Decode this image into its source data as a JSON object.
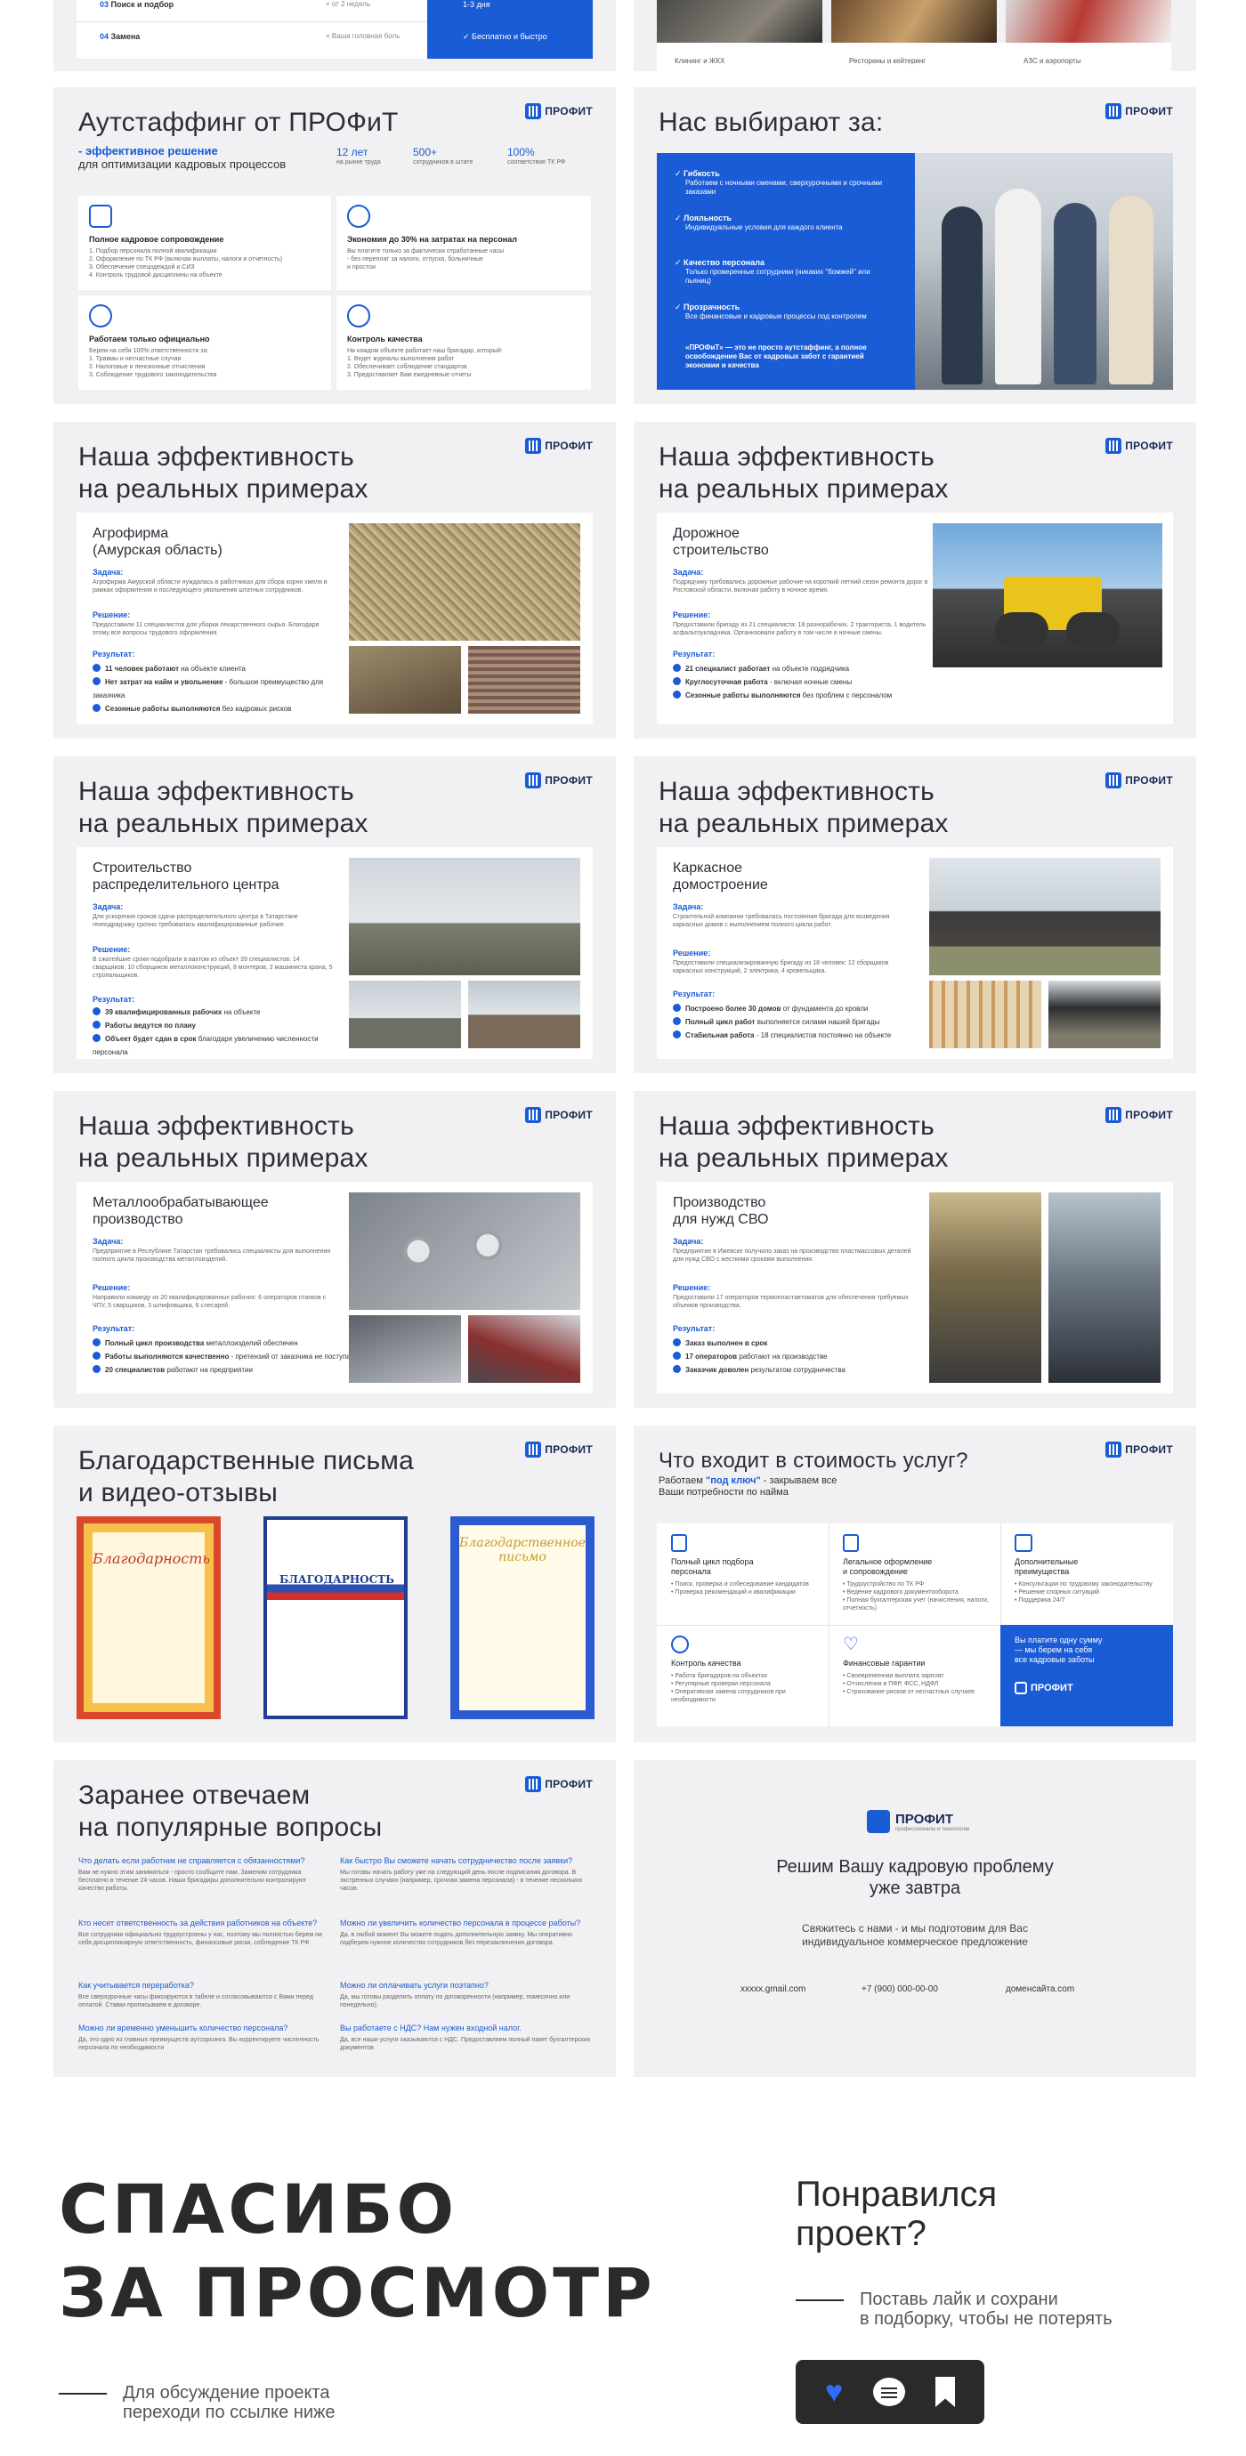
{
  "colors": {
    "accent": "#1a5bd6",
    "bg": "#f1f1f3",
    "dark": "#2a2a2a"
  },
  "logo": {
    "text": "ПРОФИТ"
  },
  "top_left": {
    "rows": [
      {
        "num": "03",
        "label": "Поиск и подбор",
        "mid": "от 2 недель"
      },
      {
        "num": "04",
        "label": "Замена",
        "mid": "Ваша головная боль"
      }
    ],
    "blue": {
      "top": "1-3 дня",
      "bottom": "Бесплатно и быстро"
    }
  },
  "top_right": {
    "captions": [
      "Клининг и ЖКХ",
      "Рестораны и кейтеринг",
      "АЗС и аэропорты"
    ]
  },
  "outstaff": {
    "title": "Аутстаффинг от ПРОФиТ",
    "lead_blue": "- эффективное решение",
    "lead": "для оптимизации кадровых процессов",
    "stats": [
      {
        "value": "12 лет",
        "label": "на рынке труда"
      },
      {
        "value": "500+",
        "label": "сотрудников в штате"
      },
      {
        "value": "100%",
        "label": "соответствие ТК РФ"
      }
    ],
    "cards": [
      {
        "title": "Полное кадровое сопровождение",
        "items": [
          "1. Подбор персонала полной квалификации",
          "2. Оформление по ТК РФ (включая выплаты, налоги и отчетность)",
          "3. Обеспечение спецодеждой и СИЗ",
          "4. Контроль трудовой дисциплины на объекте"
        ]
      },
      {
        "title": "Экономия до 30% на затратах на персонал",
        "items": [
          "Вы платите только за фактически отработанные часы",
          "- без переплат за налоги, отпуска, больничные",
          "и простои"
        ]
      },
      {
        "title": "Работаем только официально",
        "items": [
          "Берем на себя 100% ответственности за:",
          "1. Травмы и несчастные случаи",
          "2. Налоговые и пенсионные отчисления",
          "3. Соблюдение трудового законодательства"
        ]
      },
      {
        "title": "Контроль качества",
        "items": [
          "На каждом объекте работает наш бригадир, который:",
          "1. Ведет журналы выполнения работ",
          "2. Обеспечивает соблюдение стандартов",
          "3. Предоставляет Вам ежедневные отчеты"
        ]
      }
    ]
  },
  "why": {
    "title": "Нас выбирают за:",
    "items": [
      {
        "title": "Гибкость",
        "text": "Работаем с ночными сменами, сверхурочными и срочными заказами"
      },
      {
        "title": "Лояльность",
        "text": "Индивидуальные условия для каждого клиента"
      },
      {
        "title": "Качество персонала",
        "text": "Только проверенные сотрудники (никаких \"бомжей\" или пьяниц)"
      },
      {
        "title": "Прозрачность",
        "text": "Все финансовые и кадровые процессы под контролем"
      }
    ],
    "footer": "«ПРОФиТ» — это не просто аутстаффинг, а полное освобождение Вас от кадровых забот с гарантией экономии и качества"
  },
  "cases": [
    {
      "title": "Наша эффективность\nна реальных примерах",
      "name": "Агрофирма\n(Амурская область)",
      "task": "Агрофирма Амурской области нуждалась в работниках для сбора корня хмеля в рамках оформления и последующего увольнения штатных сотрудников.",
      "decision": "Предоставили 11 специалистов для уборки лекарственного сырья. Благодаря этому все вопросы трудового оформления.",
      "results": [
        [
          "11 человек работают",
          "на объекте клиента"
        ],
        [
          "Нет затрат на найм и увольнение",
          "- большое преимущество для заказчика"
        ],
        [
          "Сезонные работы выполняются",
          "без кадровых рисков"
        ]
      ]
    },
    {
      "title": "Наша эффективность\nна реальных примерах",
      "name": "Дорожное\nстроительство",
      "task": "Подрядчику требовались дорожные рабочие на короткий летний сезон ремонта дорог в Ростовской области, включая работу в ночное время.",
      "decision": "Предоставили бригаду из 21 специалиста: 18 разнорабочих, 2 тракториста, 1 водитель асфальтоукладчика. Организовали работу в том числе в ночные смены.",
      "results": [
        [
          "21 специалист работает",
          "на объекте подрядчика"
        ],
        [
          "Круглосуточная работа",
          "- включая ночные смены"
        ],
        [
          "Сезонные работы выполняются",
          "без проблем с персоналом"
        ]
      ]
    },
    {
      "title": "Наша эффективность\nна реальных примерах",
      "name": "Строительство\nраспределительного центра",
      "task": "Для ускорения сроков сдачи распределительного центра в Татарстане генподрядчику срочно требовались квалифицированные рабочие.",
      "decision": "В сжатейшие сроки подобрали в вахтом из объект 39 специалистов: 14 сварщиков, 10 сборщиков металлоконструкций, 8 монтеров, 2 машиниста крана, 5 стропальщиков.",
      "results": [
        [
          "39 квалифицированных рабочих",
          "на объекте"
        ],
        [
          "Работы ведутся по плану",
          ""
        ],
        [
          "Объект будет сдан в срок",
          "благодаря увеличению численности персонала"
        ]
      ]
    },
    {
      "title": "Наша эффективность\nна реальных примерах",
      "name": "Каркасное\nдомостроение",
      "task": "Строительной компании требовалась постоянная бригада для возведения каркасных домов с выполнением полного цикла работ.",
      "decision": "Предоставили специализированную бригаду из 18 человек: 12 сборщиков каркасных конструкций, 2 электрика, 4 кровельщика.",
      "results": [
        [
          "Построено более 30 домов",
          "от фундамента до кровли"
        ],
        [
          "Полный цикл работ",
          "выполняется силами нашей бригады"
        ],
        [
          "Стабильная работа",
          "- 18 специалистов постоянно на объекте"
        ]
      ]
    },
    {
      "title": "Наша эффективность\nна реальных примерах",
      "name": "Металлообрабатывающее\nпроизводство",
      "task": "Предприятие в Республике Татарстан требовались специалисты для выполнения полного цикла производства металлоизделий.",
      "decision": "Направили команду из 20 квалифицированных рабочих: 6 операторов станков с ЧПУ, 5 сварщиков, 3 шлифовщика, 6 слесарей.",
      "results": [
        [
          "Полный цикл производства",
          "металлоизделий обеспечен"
        ],
        [
          "Работы выполняются качественно",
          "- претензий от заказчика не поступало"
        ],
        [
          "20 специалистов",
          "работают на предприятии"
        ]
      ]
    },
    {
      "title": "Наша эффективность\nна реальных примерах",
      "name": "Производство\nдля нужд СВО",
      "task": "Предприятие в Ижевске получило заказ на производство пластмассовых деталей для нужд СВО с жесткими сроками выполнения.",
      "decision": "Предоставили 17 операторов термопластавтоматов для обеспечения требуемых объемов производства.",
      "results": [
        [
          "Заказ выполнен в срок",
          ""
        ],
        [
          "17 операторов",
          "работают на производстве"
        ],
        [
          "Заказчик доволен",
          "результатом сотрудничества"
        ]
      ]
    }
  ],
  "thanks": {
    "title": "Благодарственные письма\nи видео-отзывы",
    "letters": [
      "Благодарность",
      "БЛАГОДАРНОСТЬ",
      "Благодарственное письмо"
    ]
  },
  "cost": {
    "title": "Что входит в стоимость услуг?",
    "sub_pre": "Работаем ",
    "sub_blue": "\"под ключ\"",
    "sub_post": " - закрываем все\nВаши потребности по найма",
    "cells": [
      {
        "title": "Полный цикл подбора\nперсонала",
        "items": [
          "Поиск, проверка и собеседование кандидатов",
          "Проверка рекомендаций и квалификации"
        ]
      },
      {
        "title": "Легальное оформление\nи сопровождение",
        "items": [
          "Трудоустройство по ТК РФ",
          "Ведение кадрового документооборота",
          "Полная бухгалтерская учет (начисления, налоги, отчетность)"
        ]
      },
      {
        "title": "Дополнительные\nпреимущества",
        "items": [
          "Консультации по трудовому законодательству",
          "Решение спорных ситуаций",
          "Поддержка 24/7"
        ]
      },
      {
        "title": "Контроль качества",
        "items": [
          "Работа бригадиров на объектах",
          "Регулярные проверки персонала",
          "Оперативная замена сотрудников при необходимости"
        ]
      },
      {
        "title": "Финансовые гарантии",
        "items": [
          "Своевременная выплата зарплат",
          "Отчисления в ПФР, ФСС, НДФЛ",
          "Страхование рисков от несчастных случаев"
        ]
      }
    ],
    "blue": "Вы платите одну сумму\n— мы берем на себя\nвсе кадровые заботы"
  },
  "faq": {
    "title": "Заранее отвечаем\nна популярные вопросы",
    "items": [
      {
        "q": "Что делать если работник не справляется с обязанностями?",
        "a": "Вам не нужно этим заниматься - просто сообщите нам. Заменим сотрудника бесплатно в течение 24 часов. Наши бригадиры дополнительно контролируют качество работы."
      },
      {
        "q": "Как быстро Вы сможете начать сотрудничество после заявки?",
        "a": "Мы готовы начать работу уже на следующий день после подписания договора. В экстренных случаях (например, срочная замена персонала) - в течение нескольких часов."
      },
      {
        "q": "Кто несет ответственность за действия работников на объекте?",
        "a": "Все сотрудники официально трудоустроены у нас, поэтому мы полностью берем на себя дисциплинарную ответственность, финансовые риски, соблюдение ТК РФ."
      },
      {
        "q": "Можно ли увеличить количество персонала в процессе работы?",
        "a": "Да, в любой момент Вы можете подать дополнительную заявку. Мы оперативно подберем нужное количество сотрудников без перезаключения договора."
      },
      {
        "q": "Как учитывается переработка?",
        "a": "Все сверхурочные часы фиксируются в табеле и согласовываются с Вами перед оплатой. Ставки прописываем в договоре."
      },
      {
        "q": "Можно ли оплачивать услуги поэтапно?",
        "a": "Да, мы готовы разделить оплату по договоренности (например, помесячно или понедельно)."
      },
      {
        "q": "Можно ли временно уменьшить количество персонала?",
        "a": "Да, это одно из главных преимуществ аутсорсинга. Вы корректируете численность персонала по необходимости"
      },
      {
        "q": "Вы работаете с НДС? Нам нужен входной налог.",
        "a": "Да, все наши услуги оказываются с НДС. Предоставляем полный пакет бухгалтерских документов"
      }
    ]
  },
  "contact": {
    "logo_sub": "профессионалы и технологии",
    "title": "Решим Вашу кадровую проблему\nуже завтра",
    "text": "Свяжитесь с нами - и мы подготовим для Вас\nиндивидуальное коммерческое предложение",
    "email": "xxxxx.gmail.com",
    "phone": "+7 (900) 000-00-00",
    "site": "доменсайта.com"
  },
  "footer": {
    "big": "СПАСИБО\nЗА ПРОСМОТР",
    "note": "Для обсуждение проекта\nпереходи по ссылке ниже",
    "liked": "Понравился\nпроект?",
    "cta": "Поставь лайк и сохрани\nв подборку, чтобы не потерять"
  }
}
